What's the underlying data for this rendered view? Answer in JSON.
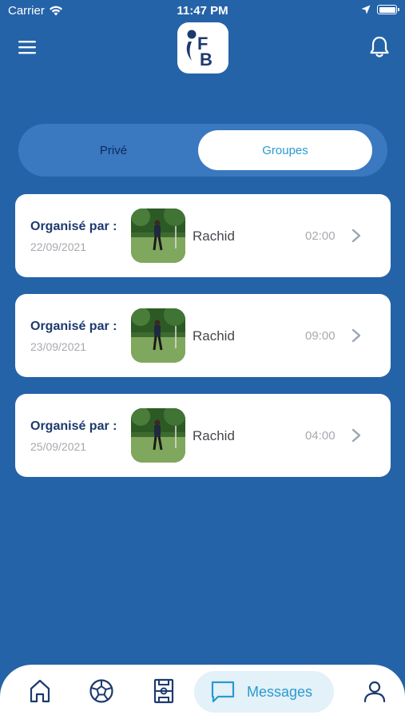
{
  "status_bar": {
    "carrier": "Carrier",
    "time": "11:47 PM"
  },
  "header": {
    "logo_text": "FB"
  },
  "tabs": [
    {
      "label": "Privé",
      "active": false
    },
    {
      "label": "Groupes",
      "active": true
    }
  ],
  "groups": [
    {
      "organizer_label": "Organisé par :",
      "date": "22/09/2021",
      "name": "Rachid",
      "time": "02:00"
    },
    {
      "organizer_label": "Organisé par :",
      "date": "23/09/2021",
      "name": "Rachid",
      "time": "09:00"
    },
    {
      "organizer_label": "Organisé par :",
      "date": "25/09/2021",
      "name": "Rachid",
      "time": "04:00"
    }
  ],
  "bottom_nav": {
    "items": [
      "home-icon",
      "ball-icon",
      "field-icon",
      "messages-icon",
      "profile-icon"
    ],
    "active_label": "Messages"
  },
  "colors": {
    "background": "#2563a8",
    "accent": "#2a9ad0",
    "navy": "#1d3a6e"
  }
}
